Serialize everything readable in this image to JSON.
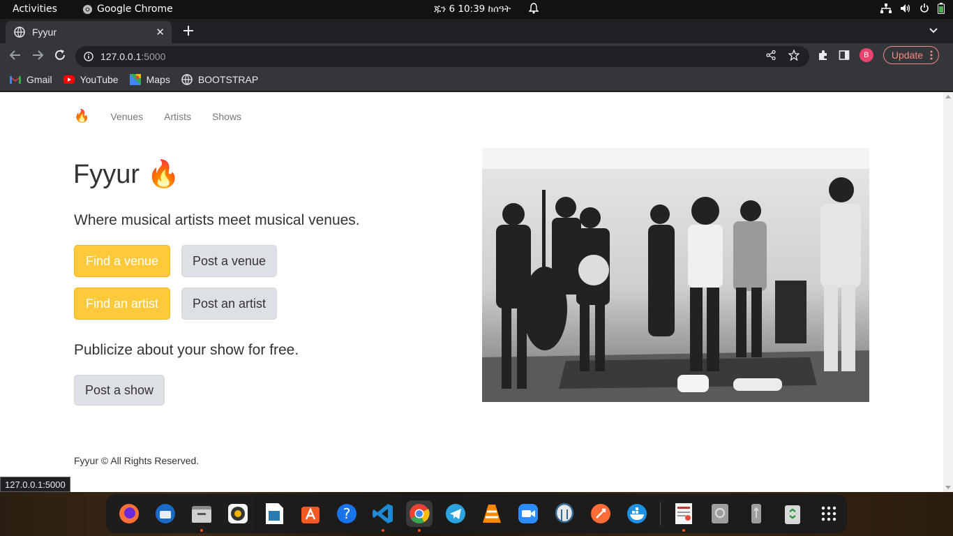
{
  "topbar": {
    "activities": "Activities",
    "app_name": "Google Chrome",
    "clock": "ጁን 6  10:39 ከሰዓት"
  },
  "browser": {
    "tab_title": "Fyyur",
    "url_host": "127.0.0.1",
    "url_port": ":5000",
    "update_label": "Update",
    "profile_initial": "B",
    "bookmarks": [
      "Gmail",
      "YouTube",
      "Maps",
      "BOOTSTRAP"
    ]
  },
  "site": {
    "nav_brand": "🔥",
    "nav": [
      "Venues",
      "Artists",
      "Shows"
    ],
    "title": "Fyyur 🔥",
    "lead": "Where musical artists meet musical venues.",
    "buttons": {
      "find_venue": "Find a venue",
      "post_venue": "Post a venue",
      "find_artist": "Find an artist",
      "post_artist": "Post an artist",
      "post_show": "Post a show"
    },
    "publicize": "Publicize about your show for free.",
    "footer": "Fyyur © All Rights Reserved."
  },
  "status_url": "127.0.0.1:5000",
  "colors": {
    "warning": "#ffc93c",
    "secondary": "#dde1e6",
    "update_accent": "#f28b82"
  },
  "dock": [
    "firefox-icon",
    "thunderbird-icon",
    "files-icon",
    "rhythmbox-icon",
    "libreoffice-writer-icon",
    "app-center-icon",
    "help-icon",
    "vscode-icon",
    "chrome-icon",
    "telegram-icon",
    "vlc-icon",
    "zoom-icon",
    "postgres-icon",
    "postman-icon",
    "docker-icon",
    "document-viewer-icon",
    "disk-icon",
    "usb-icon",
    "trash-icon",
    "app-grid-icon"
  ]
}
